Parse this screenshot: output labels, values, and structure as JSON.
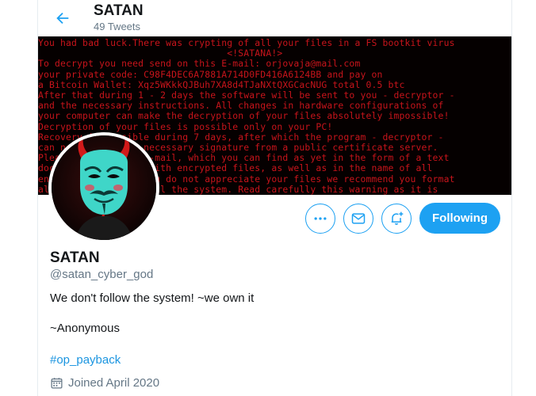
{
  "header": {
    "title": "SATAN",
    "tweet_count": "49 Tweets"
  },
  "banner": {
    "lines": [
      "You had bad luck.There was crypting of all your files in a FS bootkit virus",
      "                                  <!SATANA!>",
      "To decrypt you need send on this E-mail: orjovaja@mail.com",
      "your private code: C98F4DEC6A7881A714D0FD416A6124BB and pay on",
      "a Bitcoin Wallet: Xqz5WKkkQJBuh7XA8d4TJaNXtQXGCacNUG total 0.5 btc",
      "After that during 1 - 2 days the software will be sent to you - decryptor -",
      "and the necessary instructions. All changes in hardware configurations of",
      "your computer can make the decryption of your files absolutely impossible!",
      "Decryption of your files is possible only on your PC!",
      "Recovery is possible during 7 days, after which the program - decryptor -",
      "can not ensure the necessary signature from a public certificate server.",
      "Please contact via e-mail, which you can find as yet in the form of a text",
      "document and a file with encrypted files, as well as in the name of all",
      "encrypted files.If you do not appreciate your files we recommend you format",
      "all disks and reinstall the system. Read carefully this warning as it is"
    ],
    "text_color": "#c8141b",
    "background": "#050000"
  },
  "actions": {
    "more_icon": "more-icon",
    "message_icon": "envelope-icon",
    "notify_icon": "bell-plus-icon",
    "follow_label": "Following",
    "accent": "#1da1f2"
  },
  "profile": {
    "name": "SATAN",
    "handle": "@satan_cyber_god",
    "bio_line1": "We don't follow the system! ~we own it",
    "bio_line2": "~Anonymous",
    "hashtag": "#op_payback",
    "joined": "Joined April 2020",
    "link_color": "#1b95e0"
  }
}
